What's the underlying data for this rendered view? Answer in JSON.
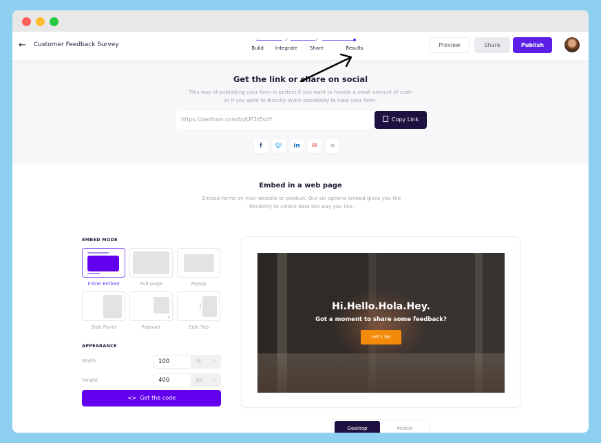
{
  "window": {
    "controls": [
      "close",
      "minimize",
      "maximize"
    ]
  },
  "header": {
    "back_icon": "arrow-left-icon",
    "title": "Customer Feedback Survey",
    "steps": [
      {
        "label": "Build",
        "state": "done"
      },
      {
        "label": "Integrate",
        "state": "done"
      },
      {
        "label": "Share",
        "state": "done"
      },
      {
        "label": "Results",
        "state": "current"
      }
    ],
    "check_glyph": "✓",
    "preview_label": "Preview",
    "share_label": "Share",
    "publish_label": "Publish",
    "accent_color": "#5b1fe8"
  },
  "share": {
    "title": "Get the link or share on social",
    "description": "This way of publishing your form is perfect if you want to handle a small amount of code or if you want to directly invite somebody to view your form.",
    "link_value": "https://zenform.com/to/UF2tEsbY",
    "copy_label": "Copy Link",
    "socials": [
      {
        "name": "facebook",
        "glyph": "f",
        "color": "#3b5998"
      },
      {
        "name": "twitter",
        "glyph": "🐦",
        "color": "#1da1f2"
      },
      {
        "name": "linkedin",
        "glyph": "in",
        "color": "#0a66c2"
      },
      {
        "name": "email",
        "glyph": "✉",
        "color": "#e53935"
      },
      {
        "name": "qr-code",
        "glyph": "⌗",
        "color": "#b0b0b5"
      }
    ]
  },
  "embed": {
    "title": "Embed in a web page",
    "description": "Embed forms on your website or product. Our six options embed gives you the flexibility to collect data the way you like.",
    "mode_label": "EMBED MODE",
    "modes": [
      {
        "label": "Inline Embed",
        "selected": true
      },
      {
        "label": "Full-page",
        "selected": false
      },
      {
        "label": "Popup",
        "selected": false
      },
      {
        "label": "Side Panel",
        "selected": false
      },
      {
        "label": "Popover",
        "selected": false
      },
      {
        "label": "Side Tab",
        "selected": false
      }
    ],
    "appearance_label": "APPEARANCE",
    "width": {
      "label": "Width",
      "value": "100",
      "unit": "%"
    },
    "height": {
      "label": "Height",
      "value": "400",
      "unit": "px"
    },
    "chevron_glyph": "⌄",
    "get_code_label": "Get the code",
    "code_icon_glyph": "<>",
    "preview": {
      "heading": "Hi.Hello.Hola.Hey.",
      "subheading": "Got a moment to share some feedback?",
      "button_label": "Let's Go",
      "button_color": "#f48a0a"
    },
    "devices": {
      "desktop_label": "Desktop",
      "mobile_label": "Mobile",
      "selected": "Desktop"
    }
  }
}
